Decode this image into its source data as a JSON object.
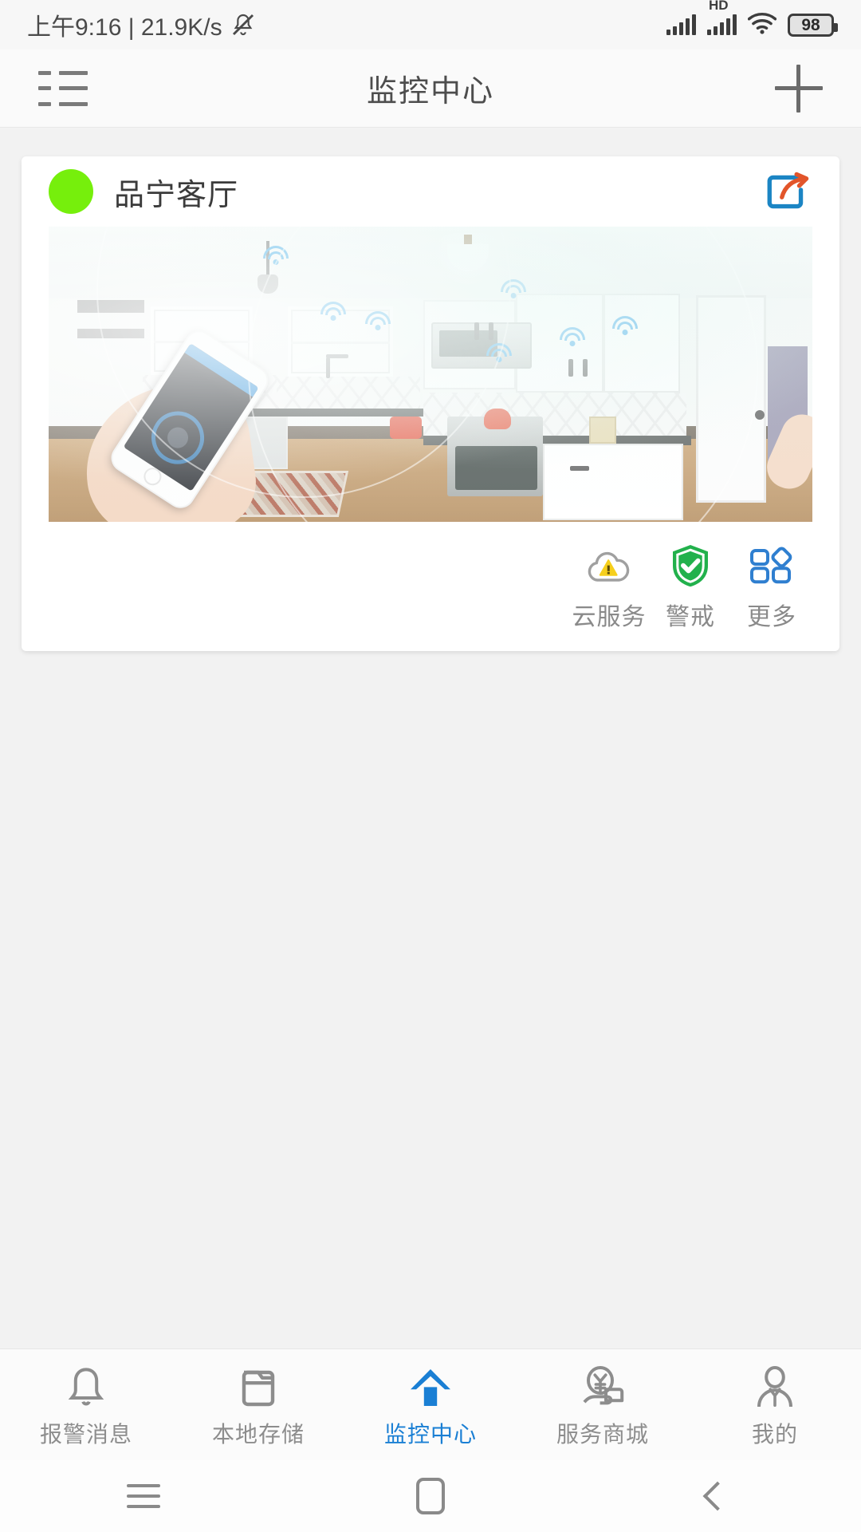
{
  "status_bar": {
    "time_and_speed": "上午9:16 | 21.9K/s",
    "mute_icon": "bell-muted-icon",
    "signal_icon": "signal-bars-icon",
    "hd_label": "HD",
    "hd_signal_icon": "hd-signal-bars-icon",
    "wifi_icon": "wifi-icon",
    "battery_level": "98"
  },
  "header": {
    "menu_icon": "list-menu-icon",
    "title": "监控中心",
    "add_icon": "plus-icon"
  },
  "device_card": {
    "status_dot_color": "#76ef0c",
    "name": "品宁客厅",
    "share_icon": "share-external-icon",
    "preview_alt": "camera-live-preview",
    "actions": [
      {
        "icon": "cloud-warning-icon",
        "label": "云服务"
      },
      {
        "icon": "shield-check-icon",
        "label": "警戒"
      },
      {
        "icon": "grid-more-icon",
        "label": "更多"
      }
    ]
  },
  "tab_bar": {
    "active_color": "#1a7fd4",
    "items": [
      {
        "icon": "bell-icon",
        "label": "报警消息",
        "active": false
      },
      {
        "icon": "folder-icon",
        "label": "本地存储",
        "active": false
      },
      {
        "icon": "home-icon",
        "label": "监控中心",
        "active": true
      },
      {
        "icon": "yuan-hand-icon",
        "label": "服务商城",
        "active": false
      },
      {
        "icon": "person-icon",
        "label": "我的",
        "active": false
      }
    ]
  },
  "system_nav": {
    "recents_icon": "recents-icon",
    "home_icon": "home-square-icon",
    "back_icon": "back-chevron-icon"
  }
}
